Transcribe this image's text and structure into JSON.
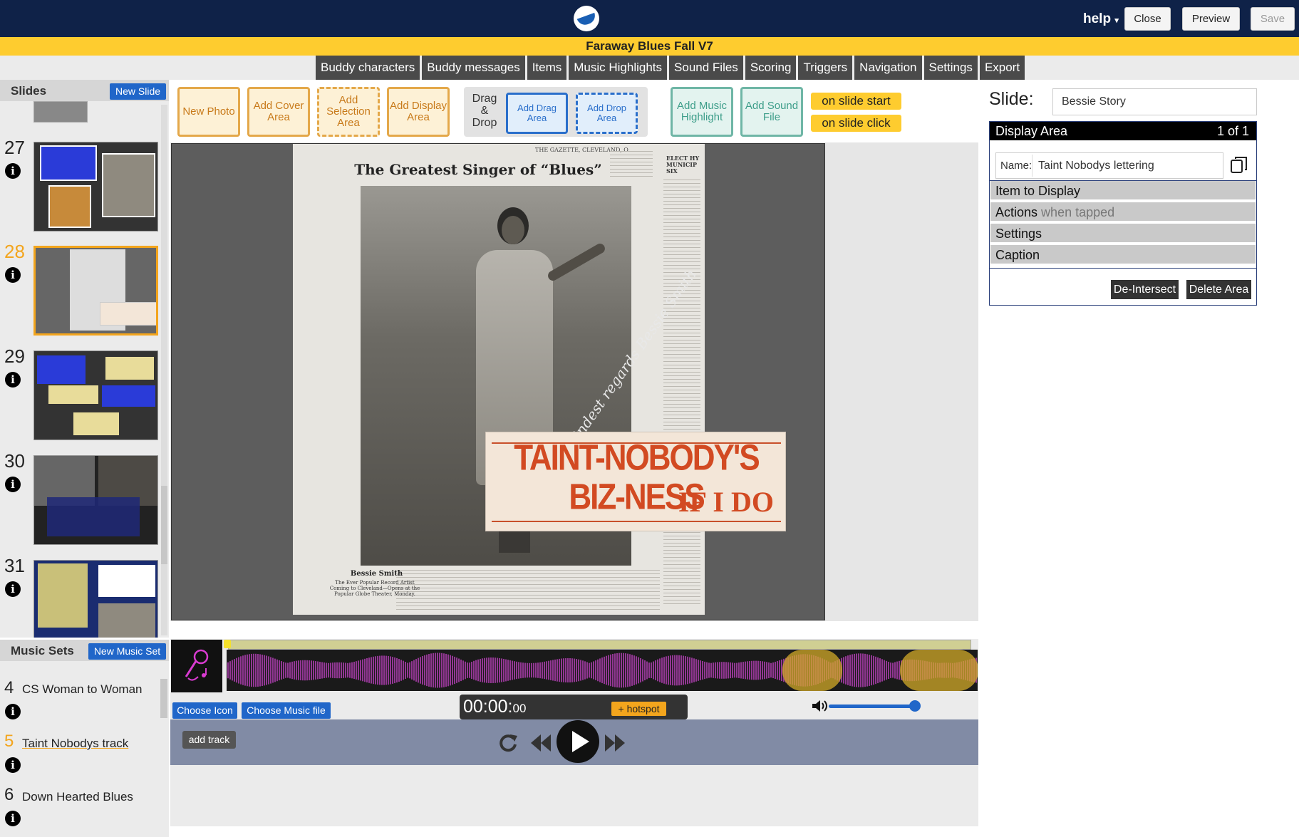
{
  "header": {
    "help_label": "help",
    "close_label": "Close",
    "preview_label": "Preview",
    "save_label": "Save",
    "project_title": "Faraway Blues Fall V7"
  },
  "menu": [
    "Buddy characters",
    "Buddy messages",
    "Items",
    "Music Highlights",
    "Sound Files",
    "Scoring",
    "Triggers",
    "Navigation",
    "Settings",
    "Export"
  ],
  "slides_panel": {
    "title": "Slides",
    "new_slide_label": "New Slide",
    "slides": [
      {
        "number": "27",
        "active": false
      },
      {
        "number": "28",
        "active": true
      },
      {
        "number": "29",
        "active": false
      },
      {
        "number": "30",
        "active": false
      },
      {
        "number": "31",
        "active": false
      }
    ]
  },
  "toolbar": {
    "new_photo": "New Photo",
    "add_cover_area": "Add Cover Area",
    "add_selection_area": "Add Selection Area",
    "add_display_area": "Add Display Area",
    "drag_drop_label": "Drag & Drop",
    "add_drag_area": "Add Drag Area",
    "add_drop_area": "Add Drop Area",
    "add_music_highlight": "Add Music Highlight",
    "add_sound_file": "Add Sound File",
    "on_slide_start": "on slide start",
    "on_slide_click": "on slide click"
  },
  "canvas": {
    "newspaper_title": "The Greatest Singer of “Blues”",
    "newspaper_caption": "Bessie Smith",
    "newspaper_sub": "The Ever Popular Record Artist Coming to Cleveland—Opens at the Popular Globe Theater, Monday.",
    "signature": "Kindest regards Bessie Smith",
    "lettering_line1": "TAINT-NOBODY'S BIZ-NESS",
    "lettering_line2": "IF I DO"
  },
  "music_sets": {
    "title": "Music Sets",
    "new_music_set_label": "New Music Set",
    "items": [
      {
        "number": "4",
        "label": "CS Woman to Woman",
        "active": false
      },
      {
        "number": "5",
        "label": "Taint Nobodys track",
        "active": true
      },
      {
        "number": "6",
        "label": "Down Hearted Blues",
        "active": false
      }
    ]
  },
  "player": {
    "choose_icon_label": "Choose Icon",
    "choose_music_file_label": "Choose Music file",
    "time_main": "00:00:",
    "time_frac": "00",
    "hotspot_label": "+ hotspot",
    "add_track_label": "add track",
    "volume_level": 0.92
  },
  "right_panel": {
    "slide_label": "Slide:",
    "slide_name": "Bessie Story",
    "display_area_title": "Display Area",
    "display_area_count": "1 of 1",
    "name_label": "Name:",
    "name_value": "Taint Nobodys lettering",
    "item_to_display": "Item to Display",
    "actions": "Actions",
    "actions_hint": "when tapped",
    "settings": "Settings",
    "caption": "Caption",
    "deintersect_label": "De-Intersect",
    "delete_area_label": "Delete Area"
  },
  "colors": {
    "navy": "#0f2248",
    "yellow": "#fecc2f",
    "blue": "#2066c9",
    "orange": "#f3a51d",
    "waveform": "#b13fb2"
  }
}
